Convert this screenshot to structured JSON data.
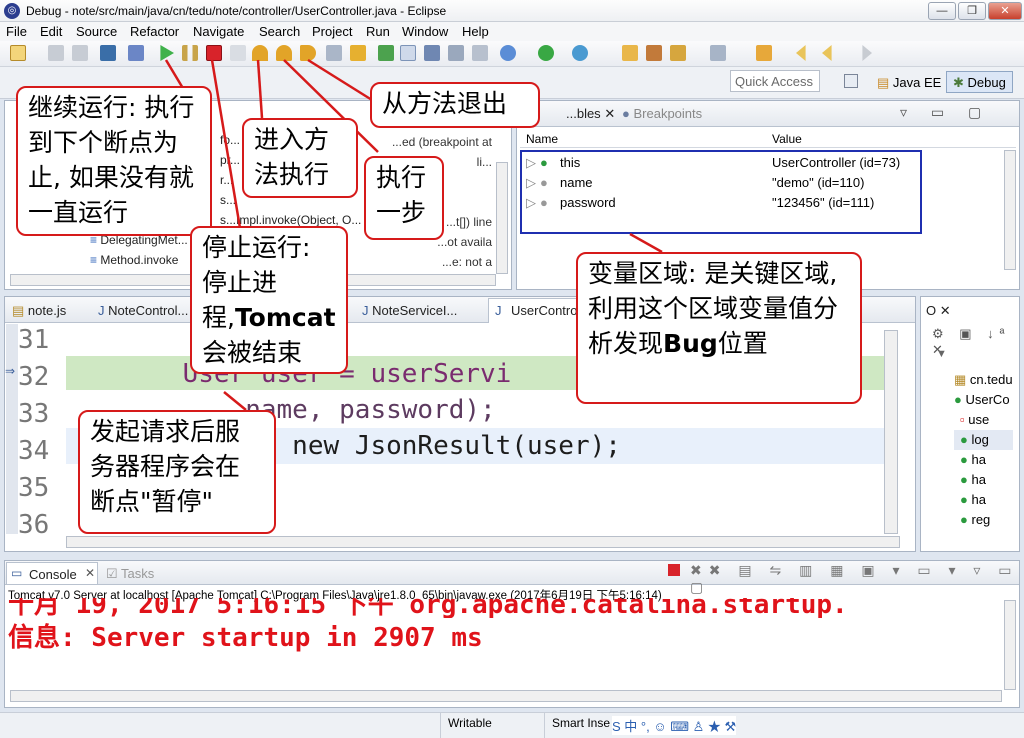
{
  "window": {
    "title": "Debug - note/src/main/java/cn/tedu/note/controller/UserController.java - Eclipse",
    "min": "—",
    "max": "❐",
    "close": "✕"
  },
  "menu": [
    "File",
    "Edit",
    "Source",
    "Refactor",
    "Navigate",
    "Search",
    "Project",
    "Run",
    "Window",
    "Help"
  ],
  "quick_access": "Quick Access",
  "perspectives": {
    "javaee": "Java EE",
    "debug": "Debug"
  },
  "debug_panel": {
    "lines": [
      "fo...",
      "pr...",
      "r...",
      "s...",
      "s...Impl.invoke(Object, O...",
      "DelegatingMet...",
      "Method.invoke"
    ],
    "right_frags": [
      "...ed (breakpoint at li...",
      "...t[]) line",
      "...ot availa",
      "...e: not a",
      "...available"
    ]
  },
  "variables": {
    "tabs": {
      "variables": "...bles",
      "breakpoints": "Breakpoints"
    },
    "header": {
      "name": "Name",
      "value": "Value"
    },
    "rows": [
      {
        "name": "this",
        "value": "UserController  (id=73)"
      },
      {
        "name": "name",
        "value": "\"demo\" (id=110)"
      },
      {
        "name": "password",
        "value": "\"123456\" (id=111)"
      }
    ]
  },
  "editor": {
    "tabs": [
      "note.js",
      "NoteControl...",
      "NoteServiceI...",
      "UserContro..."
    ],
    "lines": [
      {
        "num": "31",
        "code": ""
      },
      {
        "num": "32",
        "code": "    User user = userServi"
      },
      {
        "num": "33",
        "code": "        name, password);"
      },
      {
        "num": "34",
        "code": "    return new JsonResult(user);"
      },
      {
        "num": "35",
        "code": ""
      },
      {
        "num": "36",
        "code": ""
      }
    ]
  },
  "outline": {
    "tab": "O",
    "items": [
      "cn.tedu",
      "UserCo",
      "use",
      "log",
      "ha",
      "ha",
      "ha",
      "reg"
    ]
  },
  "console": {
    "tabs": {
      "console": "Console",
      "tasks": "Tasks"
    },
    "launch": "Tomcat v7.0 Server at localhost [Apache Tomcat] C:\\Program Files\\Java\\jre1.8.0_65\\bin\\javaw.exe (2017年6月19日 下午5:16:14)",
    "line1": "十月 19, 2017 5:16:15 下午 org.apache.catalina.startup.",
    "line2": "信息: Server startup in 2907 ms"
  },
  "status": {
    "writable": "Writable",
    "insert": "Smart Inse",
    "ime": "S 中 °, ☺ ⌨ ♙ ★ ⚒"
  },
  "callouts": {
    "resume": "继续运行: 执行到下个断点为止, 如果没有就一直运行",
    "step_into": "进入方法执行",
    "step_return": "从方法退出",
    "step_over": "执行一步",
    "terminate_a": "停止运行: 停止进程,",
    "terminate_b": "Tomcat",
    "terminate_c": "会被结束",
    "vars_a": "变量区域: 是关键区域, 利用这个区域变量值分析发现",
    "vars_b": "Bug",
    "vars_c": "位置",
    "pause": "发起请求后服务器程序会在断点\"暂停\""
  },
  "colors": {
    "callout_border": "#d61a1a",
    "var_box": "#1f2fb0",
    "console_red": "#e0131a",
    "highlight": "#cfe8c3"
  }
}
